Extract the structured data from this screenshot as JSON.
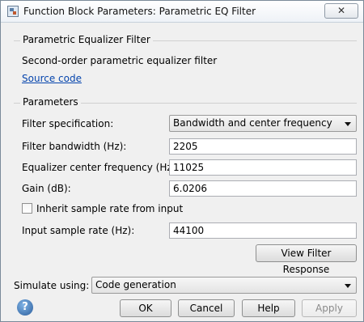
{
  "window": {
    "title": "Function Block Parameters: Parametric EQ Filter",
    "close_glyph": "✕"
  },
  "block": {
    "group_title": "Parametric Equalizer Filter",
    "description": "Second-order parametric equalizer filter",
    "source_link": "Source code"
  },
  "parameters": {
    "group_title": "Parameters",
    "filter_spec": {
      "label": "Filter specification:",
      "value": "Bandwidth and center frequency"
    },
    "bandwidth": {
      "label": "Filter bandwidth (Hz):",
      "value": "2205"
    },
    "center_freq": {
      "label": "Equalizer center frequency (Hz):",
      "value": "11025"
    },
    "gain": {
      "label": "Gain (dB):",
      "value": "6.0206"
    },
    "inherit": {
      "label": "Inherit sample rate from input",
      "checked": false
    },
    "sample_rate": {
      "label": "Input sample rate (Hz):",
      "value": "44100"
    },
    "view_response_button": "View Filter Response"
  },
  "simulate": {
    "label": "Simulate using:",
    "value": "Code generation"
  },
  "buttons": {
    "ok": "OK",
    "cancel": "Cancel",
    "help": "Help",
    "apply": "Apply"
  },
  "icons": {
    "help": "help-question-icon",
    "app": "simulink-block-icon"
  }
}
